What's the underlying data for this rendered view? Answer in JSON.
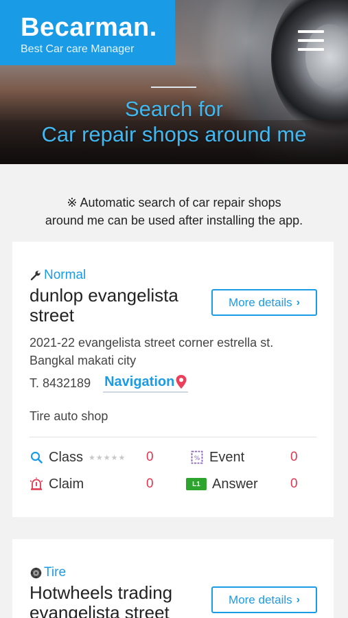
{
  "header": {
    "brand": "Becarman.",
    "tagline": "Best Car care Manager",
    "menu_icon": "hamburger-menu-icon"
  },
  "hero": {
    "title_line1": "Search for",
    "title_line2": "Car repair shops around me"
  },
  "notice": {
    "line1": "※ Automatic search of car repair shops",
    "line2": "around me can be used after installing the app."
  },
  "shops": [
    {
      "category": "Normal",
      "category_icon": "wrench-icon",
      "name": "dunlop evangelista street",
      "more_label": "More details",
      "address": "2021-22 evangelista street corner estrella st. Bangkal makati city",
      "phone": "T. 8432189",
      "nav_label": "Navigation",
      "description": "Tire auto shop",
      "stats": {
        "class_label": "Class",
        "class_stars": "★★★★★",
        "class_value": "0",
        "event_label": "Event",
        "event_value": "0",
        "claim_label": "Claim",
        "claim_value": "0",
        "answer_badge": "L1",
        "answer_label": "Answer",
        "answer_value": "0"
      }
    },
    {
      "category": "Tire",
      "category_icon": "tire-icon",
      "name": "Hotwheels trading evangelista street",
      "more_label": "More details"
    }
  ],
  "colors": {
    "accent": "#1a9be6",
    "value_red": "#e2374f",
    "hero_text": "#41b8f0"
  }
}
